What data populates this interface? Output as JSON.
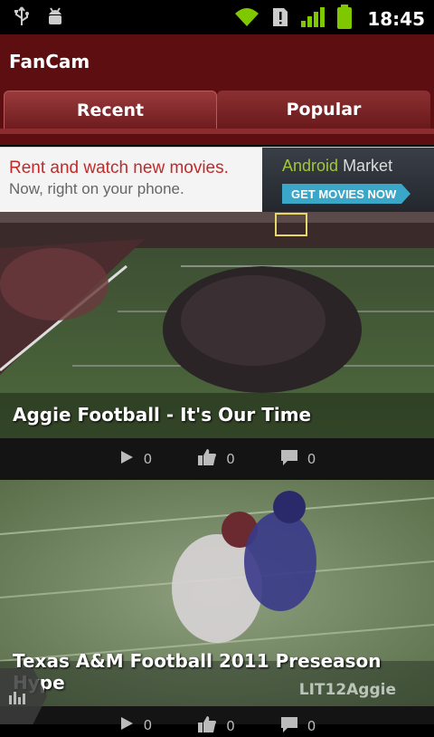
{
  "status_bar": {
    "time": "18:45",
    "icons": [
      "usb-icon",
      "android-debug-icon",
      "wifi-icon",
      "alert-icon",
      "signal-icon",
      "battery-icon"
    ]
  },
  "app": {
    "title": "FanCam"
  },
  "tabs": [
    {
      "label": "Recent",
      "selected": true
    },
    {
      "label": "Popular",
      "selected": false
    }
  ],
  "ad": {
    "line1": "Rent and watch new movies.",
    "line2": "Now, right on your phone.",
    "market_android": "Android",
    "market_word": "Market",
    "cta": "GET MOVIES NOW"
  },
  "videos": [
    {
      "title": "Aggie Football - It's Our Time",
      "plays": "0",
      "likes": "0",
      "comments": "0"
    },
    {
      "title": "Texas A&M Football 2011 Preseason Hype",
      "watermark": "LIT12Aggie",
      "plays": "0",
      "likes": "0",
      "comments": "0"
    }
  ],
  "colors": {
    "brand": "#5c0e10",
    "tab_selected": "#9a3a3c",
    "accent_cta": "#3aa6c8"
  }
}
